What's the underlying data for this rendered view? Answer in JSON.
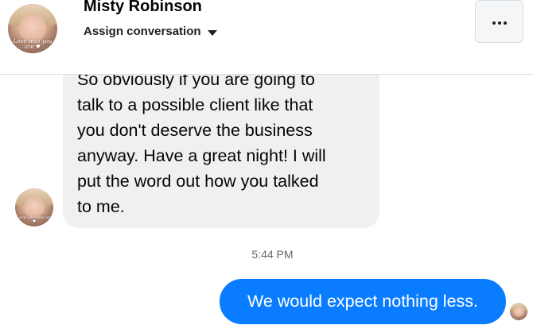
{
  "header": {
    "contact_name": "Misty Robinson",
    "assign_label": "Assign conversation",
    "avatar_caption": "Love who you are ♥",
    "more_button_icon": "more-dots-icon"
  },
  "thread": {
    "incoming_message": {
      "text": "So obviously if you are going to\ntalk to a possible client like that\nyou don't deserve the business\nanyway. Have a great night! I will\nput the word out how you talked\nto me."
    },
    "timestamp": "5:44 PM",
    "outgoing_message": {
      "text": "We would expect nothing less."
    }
  },
  "colors": {
    "outgoing_bubble": "#0a7cff",
    "incoming_bubble": "#f0f0f0",
    "timestamp_text": "#65676b"
  }
}
